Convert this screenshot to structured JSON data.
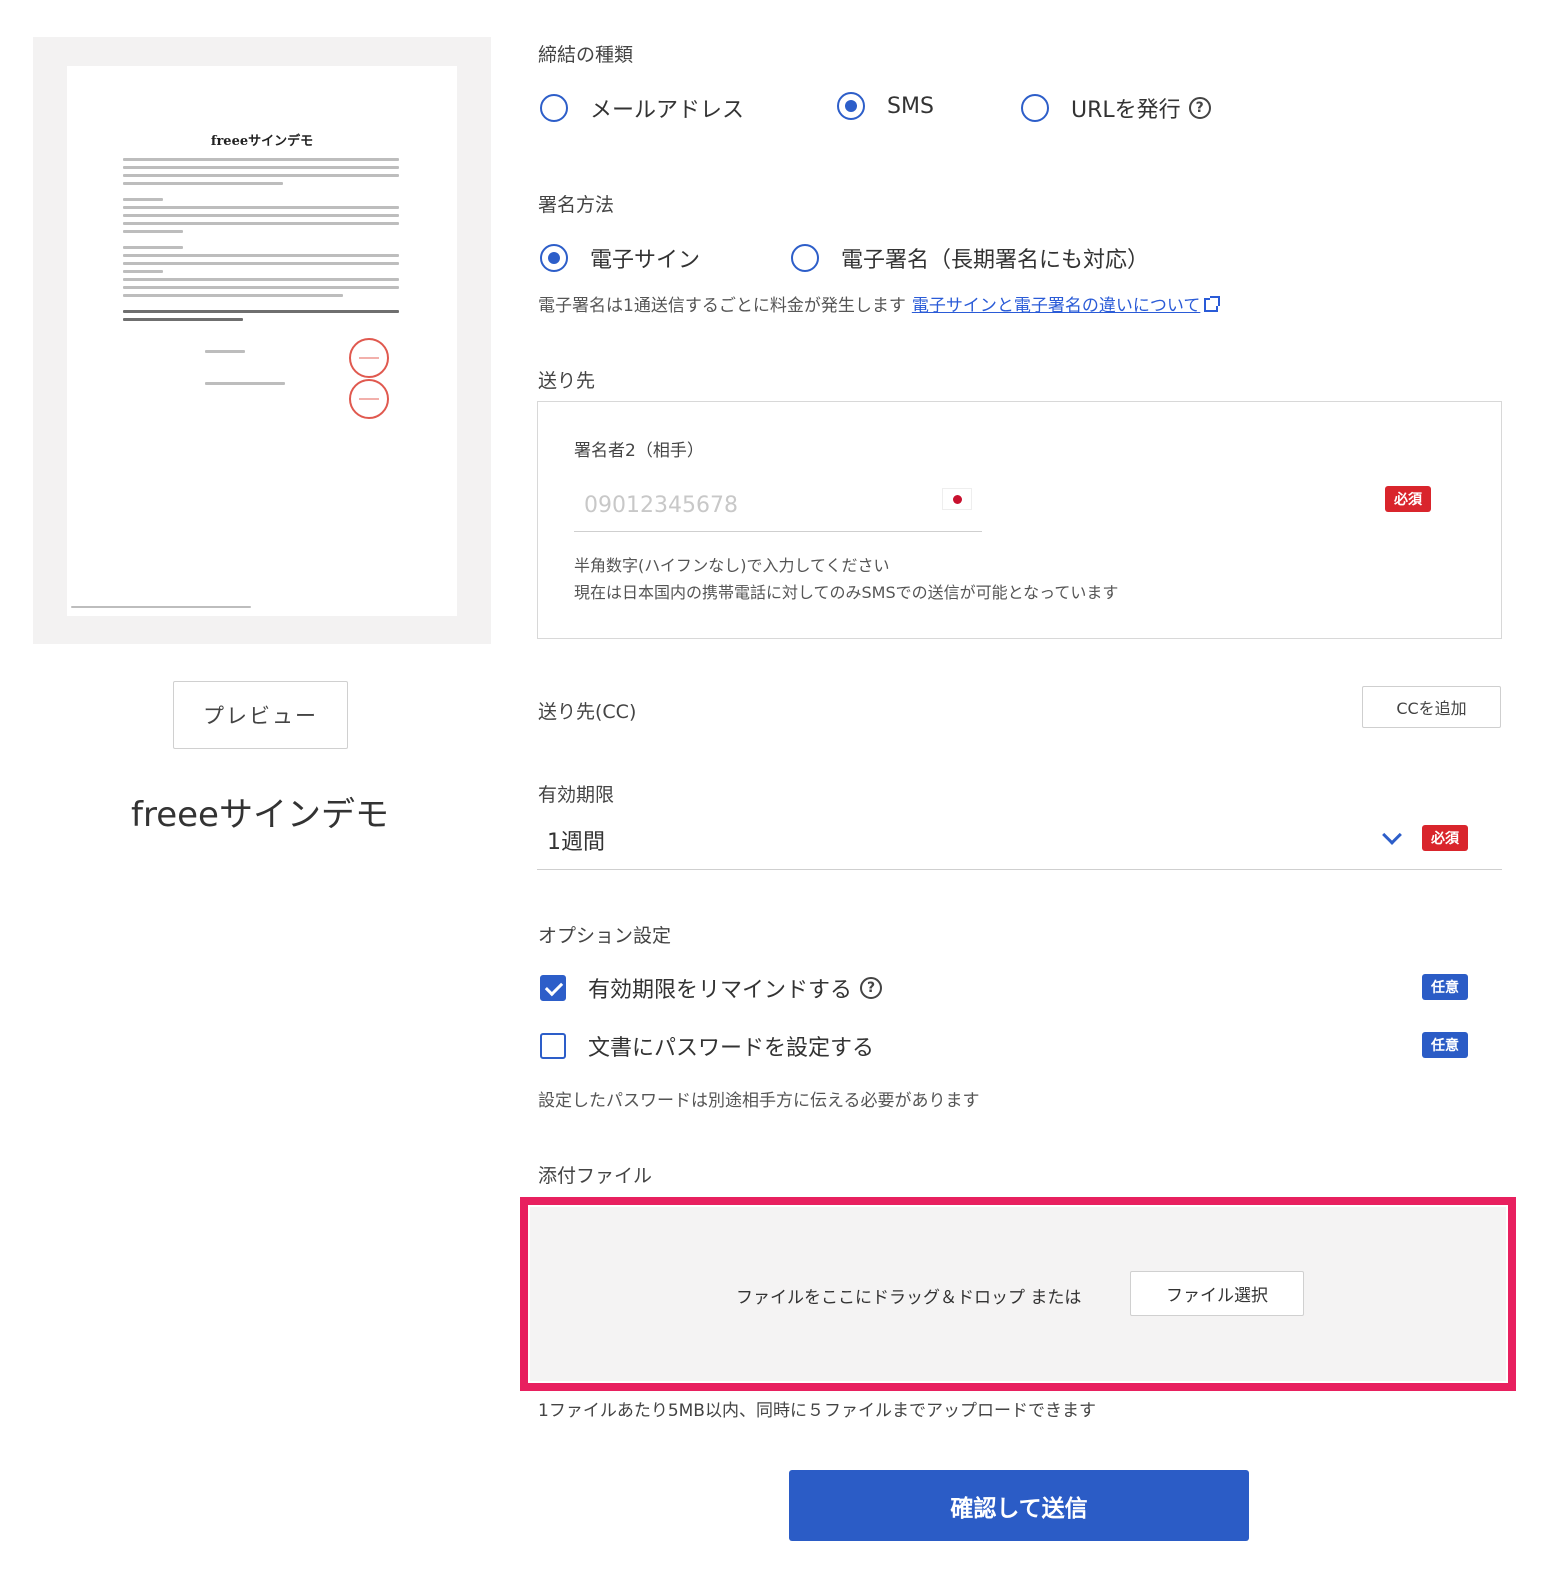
{
  "preview": {
    "doc_title": "freeeサインデモ",
    "button_label": "プレビュー",
    "document_name": "freeeサインデモ"
  },
  "contract_type": {
    "label": "締結の種類",
    "options": [
      "メールアドレス",
      "SMS",
      "URLを発行"
    ],
    "selected": "SMS"
  },
  "sign_method": {
    "label": "署名方法",
    "options": [
      "電子サイン",
      "電子署名（長期署名にも対応）"
    ],
    "selected": "電子サイン",
    "note": "電子署名は1通送信するごとに料金が発生します",
    "link_text": "電子サインと電子署名の違いについて"
  },
  "destination": {
    "label": "送り先",
    "signer_label": "署名者2（相手）",
    "phone_placeholder": "09012345678",
    "required_badge": "必須",
    "hint_1": "半角数字(ハイフンなし)で入力してください",
    "hint_2": "現在は日本国内の携帯電話に対してのみSMSでの送信が可能となっています"
  },
  "cc": {
    "label": "送り先(CC)",
    "button_label": "CCを追加"
  },
  "expiry": {
    "label": "有効期限",
    "value": "1週間",
    "required_badge": "必須"
  },
  "options": {
    "label": "オプション設定",
    "remind_label": "有効期限をリマインドする",
    "remind_checked": true,
    "password_label": "文書にパスワードを設定する",
    "password_checked": false,
    "optional_badge": "任意",
    "password_note": "設定したパスワードは別途相手方に伝える必要があります"
  },
  "attachment": {
    "label": "添付ファイル",
    "drop_text": "ファイルをここにドラッグ＆ドロップ または",
    "file_button": "ファイル選択",
    "limit_note": "1ファイルあたり5MB以内、同時に５ファイルまでアップロードできます"
  },
  "submit": {
    "label": "確認して送信"
  },
  "colors": {
    "primary": "#2b5cc6",
    "required": "#d9252c",
    "highlight": "#e8205f"
  }
}
